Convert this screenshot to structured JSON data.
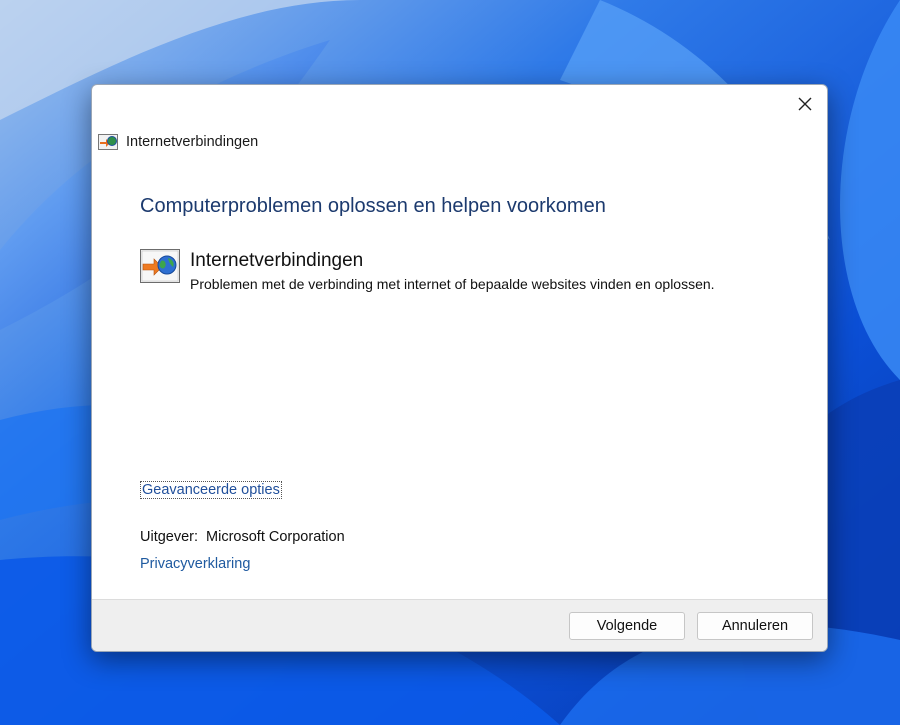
{
  "window": {
    "title": "Internetverbindingen",
    "close_icon": "close-icon"
  },
  "main": {
    "heading": "Computerproblemen oplossen en helpen voorkomen",
    "item": {
      "icon": "internet-connections-icon",
      "title": "Internetverbindingen",
      "description": "Problemen met de verbinding met internet of bepaalde websites vinden en oplossen."
    },
    "advanced_link": "Geavanceerde opties",
    "publisher_label": "Uitgever:",
    "publisher_value": "Microsoft Corporation",
    "privacy_link": "Privacyverklaring"
  },
  "footer": {
    "next_label": "Volgende",
    "cancel_label": "Annuleren"
  },
  "colors": {
    "heading": "#1c3a6e",
    "link": "#1f5aa0",
    "footer_bg": "#efefef",
    "wallpaper_blue": "#0a5de0"
  }
}
